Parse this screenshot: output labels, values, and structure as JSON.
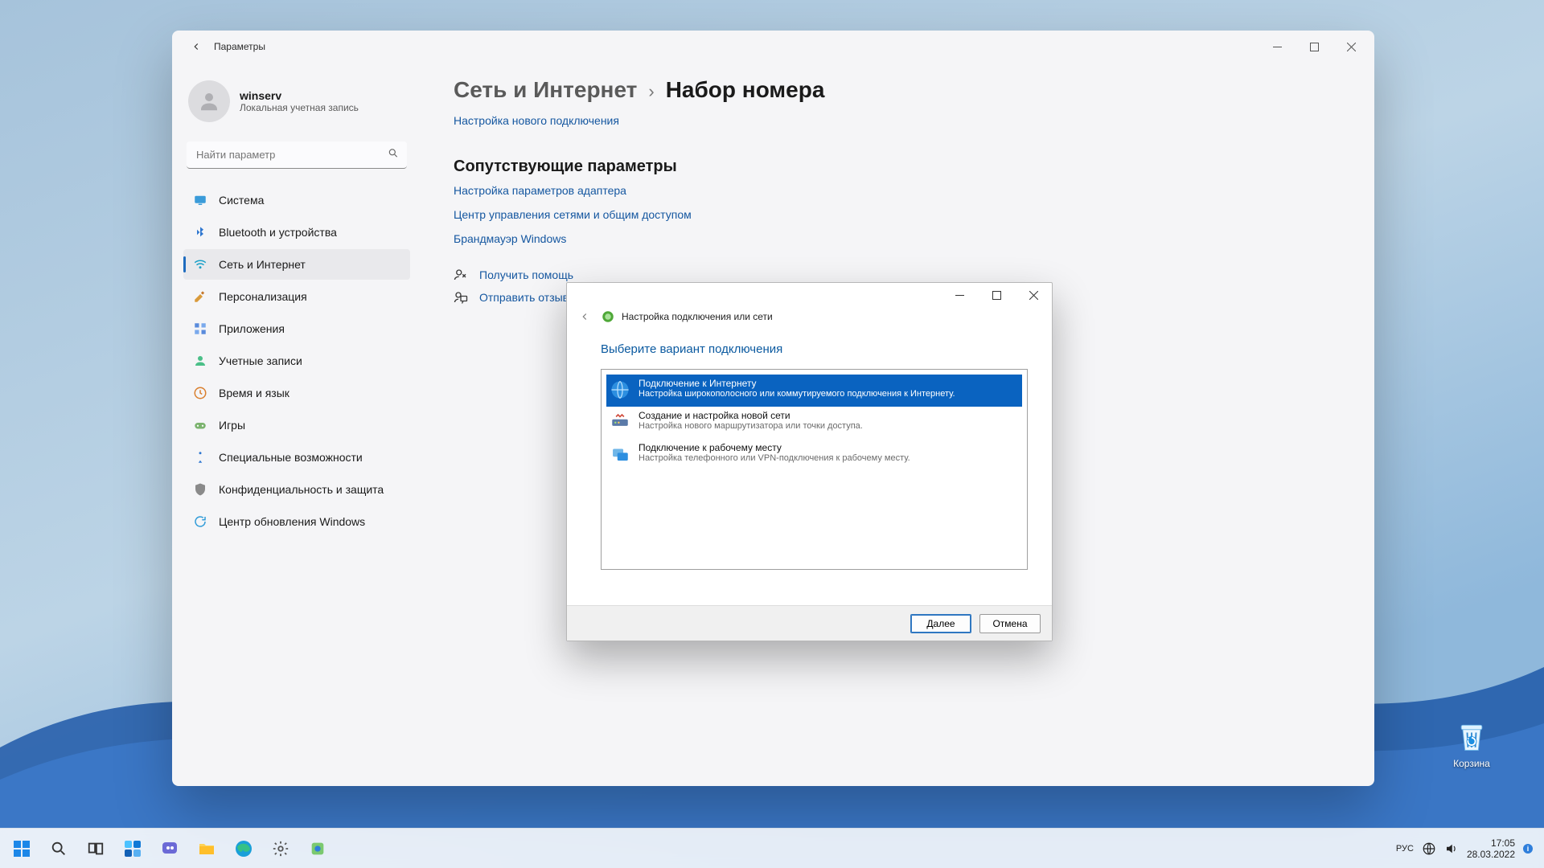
{
  "settings": {
    "window_title": "Параметры",
    "user": {
      "name": "winserv",
      "subtitle": "Локальная учетная запись"
    },
    "search_placeholder": "Найти параметр",
    "nav": [
      {
        "id": "system",
        "label": "Система"
      },
      {
        "id": "bluetooth",
        "label": "Bluetooth и устройства"
      },
      {
        "id": "network",
        "label": "Сеть и Интернет",
        "active": true
      },
      {
        "id": "personalization",
        "label": "Персонализация"
      },
      {
        "id": "apps",
        "label": "Приложения"
      },
      {
        "id": "accounts",
        "label": "Учетные записи"
      },
      {
        "id": "time",
        "label": "Время и язык"
      },
      {
        "id": "gaming",
        "label": "Игры"
      },
      {
        "id": "accessibility",
        "label": "Специальные возможности"
      },
      {
        "id": "privacy",
        "label": "Конфиденциальность и защита"
      },
      {
        "id": "update",
        "label": "Центр обновления Windows"
      }
    ],
    "breadcrumb": {
      "parent": "Сеть и Интернет",
      "current": "Набор номера"
    },
    "links": {
      "new_connection": "Настройка нового подключения",
      "related_header": "Сопутствующие параметры",
      "adapter": "Настройка параметров адаптера",
      "sharing_center": "Центр управления сетями и общим доступом",
      "firewall": "Брандмауэр Windows",
      "get_help": "Получить помощь",
      "feedback": "Отправить отзыв"
    }
  },
  "wizard": {
    "title": "Настройка подключения или сети",
    "heading": "Выберите вариант подключения",
    "options": [
      {
        "title": "Подключение к Интернету",
        "desc": "Настройка широкополосного или коммутируемого подключения к Интернету.",
        "selected": true
      },
      {
        "title": "Создание и настройка новой сети",
        "desc": "Настройка нового маршрутизатора или точки доступа."
      },
      {
        "title": "Подключение к рабочему месту",
        "desc": "Настройка телефонного или VPN-подключения к рабочему месту."
      }
    ],
    "buttons": {
      "next": "Далее",
      "cancel": "Отмена"
    }
  },
  "desktop": {
    "recycle_bin": "Корзина"
  },
  "taskbar": {
    "lang": "РУС",
    "time": "17:05",
    "date": "28.03.2022"
  }
}
